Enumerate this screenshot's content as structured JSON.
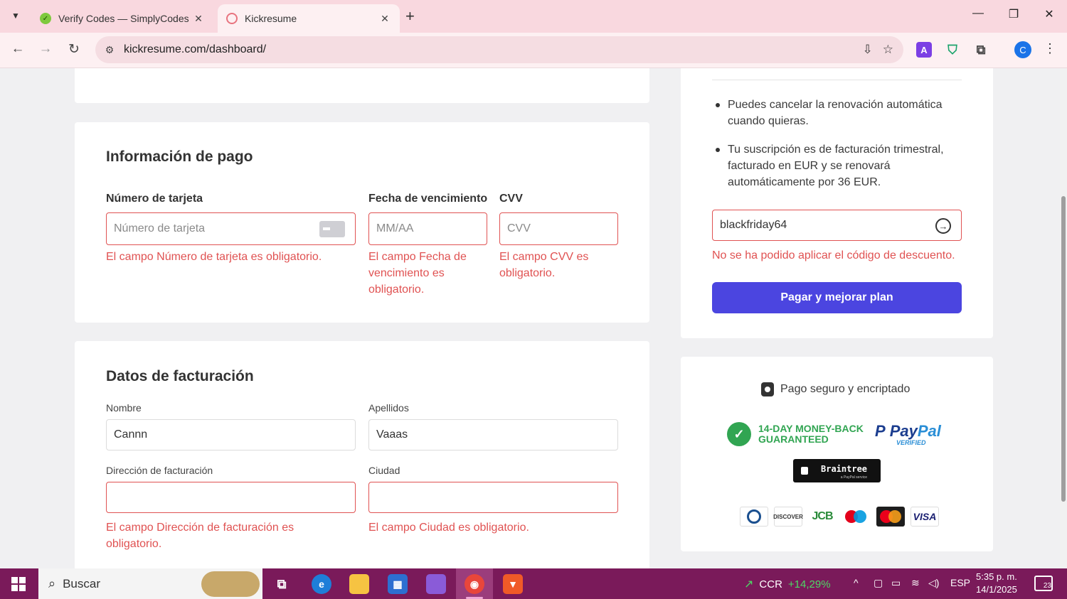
{
  "browser": {
    "tabs": [
      {
        "title": "Verify Codes — SimplyCodes",
        "active": false
      },
      {
        "title": "Kickresume",
        "active": true
      }
    ],
    "url": "kickresume.com/dashboard/",
    "profile_initial": "C",
    "extension_a_label": "A"
  },
  "payment": {
    "title": "Información de pago",
    "card_number": {
      "label": "Número de tarjeta",
      "placeholder": "Número de tarjeta",
      "error": "El campo Número de tarjeta es obligatorio."
    },
    "expiry": {
      "label": "Fecha de vencimiento",
      "placeholder": "MM/AA",
      "error": "El campo Fecha de vencimiento es obligatorio."
    },
    "cvv": {
      "label": "CVV",
      "placeholder": "CVV",
      "error": "El campo CVV es obligatorio."
    }
  },
  "billing": {
    "title": "Datos de facturación",
    "first_name": {
      "label": "Nombre",
      "value": "Cannn"
    },
    "last_name": {
      "label": "Apellidos",
      "value": "Vaaas"
    },
    "address": {
      "label": "Dirección de facturación",
      "value": "",
      "error": "El campo Dirección de facturación es obligatorio."
    },
    "city": {
      "label": "Ciudad",
      "value": "",
      "error": "El campo Ciudad es obligatorio."
    }
  },
  "summary": {
    "bullets": [
      "Puedes cancelar la renovación automática cuando quieras.",
      "Tu suscripción es de facturación trimestral, facturado en EUR y se renovará automáticamente por 36 EUR."
    ],
    "coupon_value": "blackfriday64",
    "coupon_error": "No se ha podido aplicar el código de descuento.",
    "pay_button": "Pagar y mejorar plan"
  },
  "trust": {
    "secure_text": "Pago seguro y encriptado",
    "money_back_line1": "14-DAY MONEY-BACK",
    "money_back_line2": "GUARANTEED",
    "paypal_p": "P",
    "paypal_pay": "Pay",
    "paypal_pal": "Pal",
    "paypal_verified": "VERIFIED",
    "braintree": "Braintree",
    "braintree_sub": "a PayPal service",
    "discover": "DISCOVER",
    "jcb": "JCB",
    "visa": "VISA",
    "colors": {
      "money_back": "#31a552",
      "paypal_dark": "#1b3d8f",
      "paypal_light": "#2a8ed6",
      "maestro_red": "#e3001b",
      "maestro_blue": "#0099df",
      "master_red": "#eb001b",
      "master_orange": "#f79e1b"
    }
  },
  "taskbar": {
    "search_placeholder": "Buscar",
    "stock_name": "CCR",
    "stock_change": "+14,29%",
    "language": "ESP",
    "time": "5:35 p. m.",
    "date": "14/1/2025",
    "notifications": "23"
  },
  "colors": {
    "accent": "#4b45e0",
    "error": "#e05252",
    "tabbar": "#f9d8df",
    "taskbar": "#7a1a5a"
  }
}
